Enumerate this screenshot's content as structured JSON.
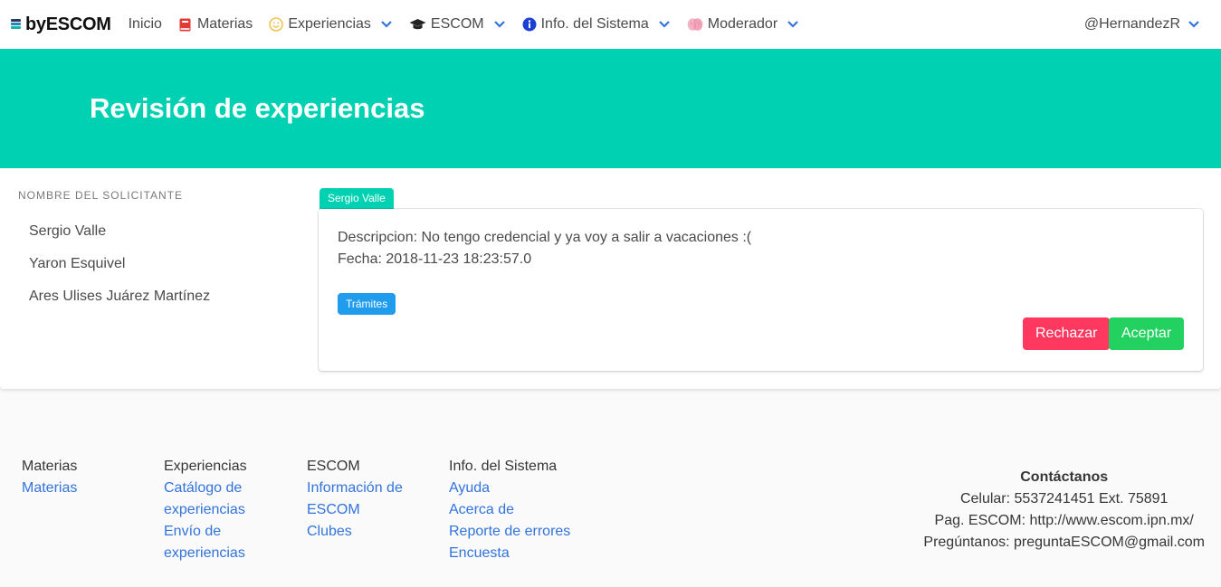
{
  "navbar": {
    "brand": "byESCOM",
    "items": [
      {
        "label": "Inicio",
        "icon": "none",
        "dropdown": false
      },
      {
        "label": "Materias",
        "icon": "book-icon",
        "dropdown": false
      },
      {
        "label": "Experiencias",
        "icon": "smile-icon",
        "dropdown": true
      },
      {
        "label": "ESCOM",
        "icon": "graduation-cap-icon",
        "dropdown": true
      },
      {
        "label": "Info. del Sistema",
        "icon": "info-circle-icon",
        "dropdown": true
      },
      {
        "label": "Moderador",
        "icon": "brain-icon",
        "dropdown": true
      }
    ],
    "user": "@HernandezR"
  },
  "hero": {
    "title": "Revisión de experiencias"
  },
  "sidebar": {
    "label": "Nombre del solicitante",
    "items": [
      "Sergio Valle",
      "Yaron Esquivel",
      "Ares Ulises Juárez Martínez"
    ]
  },
  "experience": {
    "requester_tag": "Sergio Valle",
    "description": "Descripcion: No tengo credencial y ya voy a salir a vacaciones :(",
    "date": "Fecha: 2018-11-23 18:23:57.0",
    "topic_tag": "Trámites",
    "reject_label": "Rechazar",
    "accept_label": "Aceptar"
  },
  "footer": {
    "columns": [
      {
        "heading": "Materias",
        "links": [
          "Materias"
        ]
      },
      {
        "heading": "Experiencias",
        "links": [
          "Catálogo de",
          "experiencias",
          "Envío de",
          "experiencias"
        ]
      },
      {
        "heading": "ESCOM",
        "links": [
          "Información de",
          "ESCOM",
          "Clubes"
        ]
      },
      {
        "heading": "Info. del Sistema",
        "links": [
          "Ayuda",
          "Acerca de",
          "Reporte de errores",
          "Encuesta"
        ]
      }
    ],
    "contact": {
      "heading": "Contáctanos",
      "phone": "Celular: 5537241451 Ext. 75891",
      "page": "Pag. ESCOM: http://www.escom.ipn.mx/",
      "email": "Pregúntanos: preguntaESCOM@gmail.com"
    }
  },
  "colors": {
    "primary": "#00d1b2",
    "info": "#209cee",
    "danger": "#ff3860",
    "success": "#23d160",
    "link": "#3273dc"
  }
}
